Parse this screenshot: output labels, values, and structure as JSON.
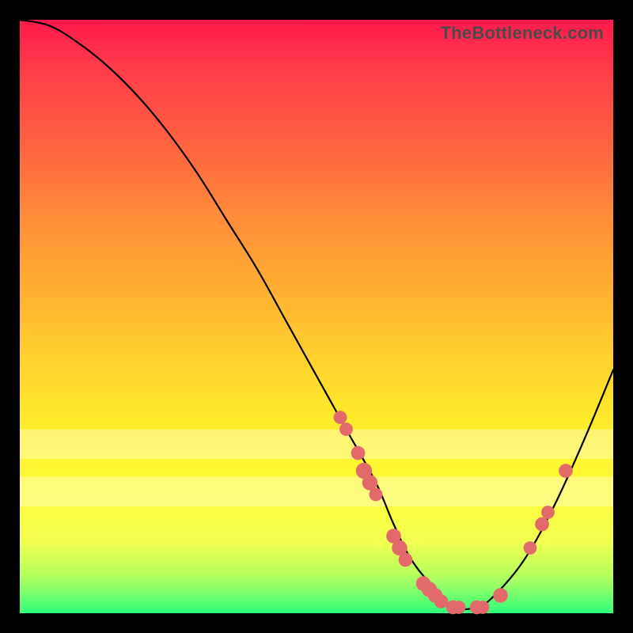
{
  "watermark": "TheBottleneck.com",
  "colors": {
    "marker": "#e26a6a",
    "curve": "#000000"
  },
  "chart_data": {
    "type": "line",
    "title": "",
    "xlabel": "",
    "ylabel": "",
    "xlim": [
      0,
      100
    ],
    "ylim": [
      0,
      100
    ],
    "grid": false,
    "legend": false,
    "series": [
      {
        "name": "bottleneck-curve",
        "x": [
          0,
          5,
          10,
          15,
          20,
          25,
          30,
          35,
          40,
          45,
          50,
          55,
          60,
          63,
          66,
          70,
          73,
          77,
          80,
          85,
          90,
          95,
          100
        ],
        "y": [
          100,
          99,
          96,
          92,
          87,
          81,
          74,
          66,
          58,
          49,
          40,
          31,
          22,
          15,
          9,
          4,
          1,
          1,
          3,
          9,
          18,
          29,
          41
        ]
      }
    ],
    "markers": [
      {
        "x": 54,
        "y": 33,
        "r": 1.2
      },
      {
        "x": 55,
        "y": 31,
        "r": 1.2
      },
      {
        "x": 57,
        "y": 27,
        "r": 1.3
      },
      {
        "x": 58,
        "y": 24,
        "r": 1.6
      },
      {
        "x": 59,
        "y": 22,
        "r": 1.5
      },
      {
        "x": 60,
        "y": 20,
        "r": 1.2
      },
      {
        "x": 63,
        "y": 13,
        "r": 1.4
      },
      {
        "x": 64,
        "y": 11,
        "r": 1.5
      },
      {
        "x": 65,
        "y": 9,
        "r": 1.3
      },
      {
        "x": 68,
        "y": 5,
        "r": 1.4
      },
      {
        "x": 69,
        "y": 4,
        "r": 1.5
      },
      {
        "x": 70,
        "y": 3,
        "r": 1.4
      },
      {
        "x": 71,
        "y": 2,
        "r": 1.3
      },
      {
        "x": 73,
        "y": 1,
        "r": 1.3
      },
      {
        "x": 74,
        "y": 1,
        "r": 1.2
      },
      {
        "x": 77,
        "y": 1,
        "r": 1.3
      },
      {
        "x": 78,
        "y": 1,
        "r": 1.2
      },
      {
        "x": 81,
        "y": 3,
        "r": 1.4
      },
      {
        "x": 86,
        "y": 11,
        "r": 1.2
      },
      {
        "x": 88,
        "y": 15,
        "r": 1.3
      },
      {
        "x": 89,
        "y": 17,
        "r": 1.2
      },
      {
        "x": 92,
        "y": 24,
        "r": 1.3
      }
    ],
    "pale_bands_y": [
      {
        "y0": 18,
        "y1": 23
      },
      {
        "y0": 26,
        "y1": 31
      }
    ]
  }
}
